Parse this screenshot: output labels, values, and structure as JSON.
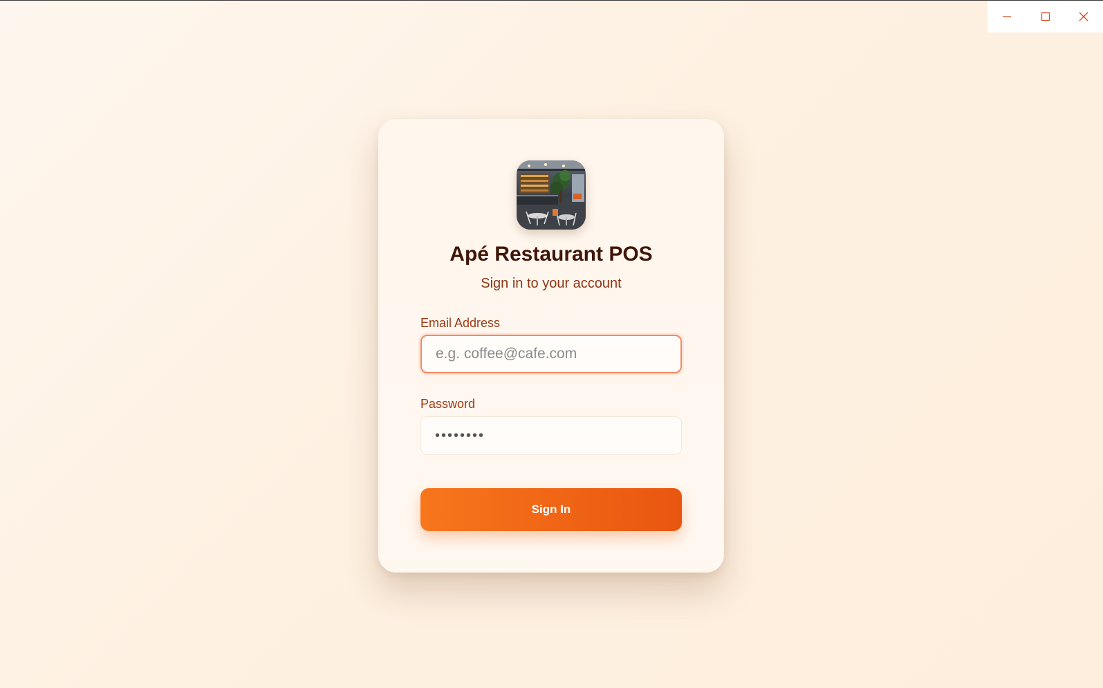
{
  "window": {
    "controls": {
      "minimize_icon": "minimize-icon",
      "maximize_icon": "maximize-icon",
      "close_icon": "close-icon",
      "icon_color": "#d9532a"
    }
  },
  "login": {
    "logo_icon": "restaurant-photo",
    "title": "Apé Restaurant POS",
    "subtitle": "Sign in to your account",
    "email": {
      "label": "Email Address",
      "placeholder": "e.g. coffee@cafe.com",
      "value": ""
    },
    "password": {
      "label": "Password",
      "masked_value": "••••••••"
    },
    "submit_label": "Sign In"
  },
  "colors": {
    "title": "#3f1608",
    "label": "#9a3a14",
    "accent_start": "#f7761c",
    "accent_end": "#e95610",
    "focus_border": "#f18a62"
  }
}
